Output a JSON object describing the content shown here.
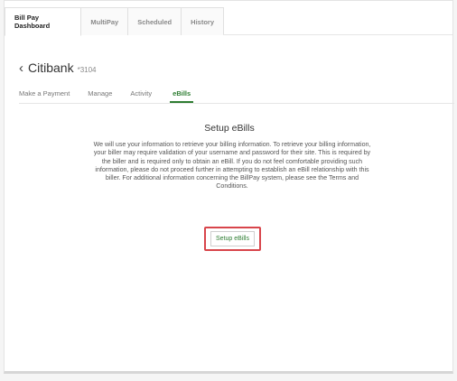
{
  "top_tabs": [
    {
      "label": "Bill Pay Dashboard"
    },
    {
      "label": "MultiPay"
    },
    {
      "label": "Scheduled"
    },
    {
      "label": "History"
    }
  ],
  "biller": {
    "name": "Citibank",
    "account": "*3104"
  },
  "sub_tabs": [
    {
      "label": "Make a Payment"
    },
    {
      "label": "Manage"
    },
    {
      "label": "Activity"
    },
    {
      "label": "eBills"
    }
  ],
  "content": {
    "title": "Setup eBills",
    "body": "We will use your information to retrieve your billing information. To retrieve your billing information, your biller may require validation of your username and password for their site. This is required by the biller and is required only to obtain an eBill. If you do not feel comfortable providing such information, please do not proceed further in attempting to establish an eBill relationship with this biller. For additional information concerning the BillPay system, please see the Terms and Conditions.",
    "button_label": "Setup eBills"
  },
  "colors": {
    "accent": "#2e7d32",
    "highlight": "#d8454b"
  }
}
